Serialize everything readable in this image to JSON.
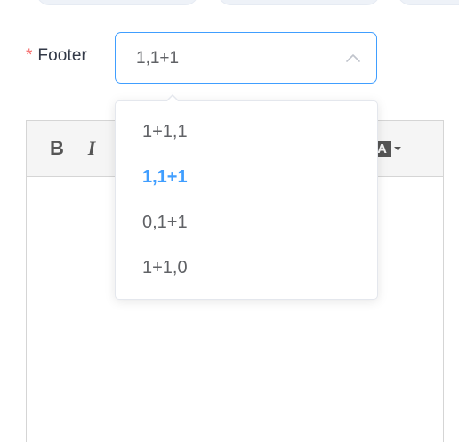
{
  "form": {
    "required_mark": "*",
    "label": "Footer"
  },
  "select": {
    "value": "1,1+1",
    "open": true,
    "accent_color": "#409eff"
  },
  "dropdown": {
    "options": [
      {
        "label": "1+1,1",
        "selected": false
      },
      {
        "label": "1,1+1",
        "selected": true
      },
      {
        "label": "0,1+1",
        "selected": false
      },
      {
        "label": "1+1,0",
        "selected": false
      }
    ]
  },
  "editor": {
    "toolbar": {
      "bold_label": "B",
      "italic_label": "I",
      "bgcolor_label": "A"
    }
  },
  "icons": {
    "select_arrow": "chevron-up-icon",
    "bgcolor_caret": "caret-down-icon"
  }
}
